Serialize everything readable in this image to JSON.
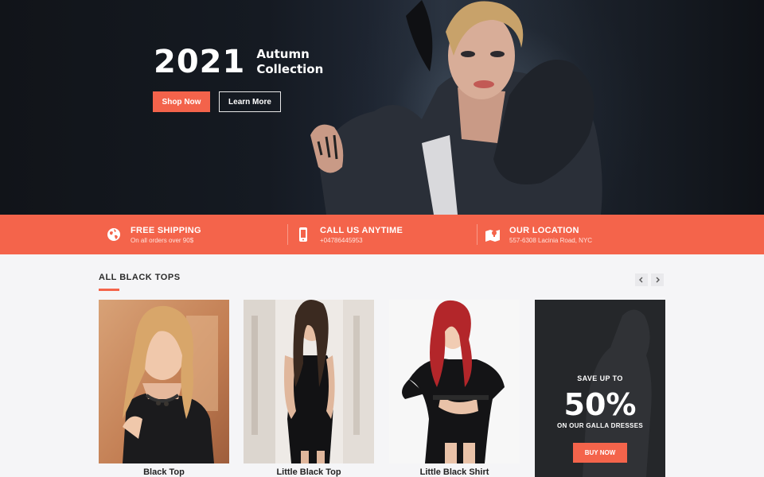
{
  "hero": {
    "year": "2021",
    "subtitle_line1": "Autumn",
    "subtitle_line2": "Collection",
    "shop_button": "Shop Now",
    "learn_button": "Learn More"
  },
  "infobar": {
    "items": [
      {
        "title": "FREE SHIPPING",
        "subtitle": "On all orders over 90$",
        "icon": "globe-icon"
      },
      {
        "title": "CALL US ANYTIME",
        "subtitle": "+04786445953",
        "icon": "phone-icon"
      },
      {
        "title": "OUR LOCATION",
        "subtitle": "557-6308 Lacinia Road, NYC",
        "icon": "map-icon"
      }
    ]
  },
  "section": {
    "title": "ALL BLACK TOPS",
    "prev_icon": "chevron-left-icon",
    "next_icon": "chevron-right-icon"
  },
  "products": [
    {
      "name": "Black Top"
    },
    {
      "name": "Little Black Top"
    },
    {
      "name": "Little Black Shirt"
    }
  ],
  "promo": {
    "pre": "SAVE UP TO",
    "big": "50%",
    "post": "ON OUR GALLA DRESSES",
    "button": "BUY NOW"
  },
  "colors": {
    "accent": "#f4644b",
    "hero_bg": "#111419",
    "page_bg": "#f5f5f7"
  }
}
